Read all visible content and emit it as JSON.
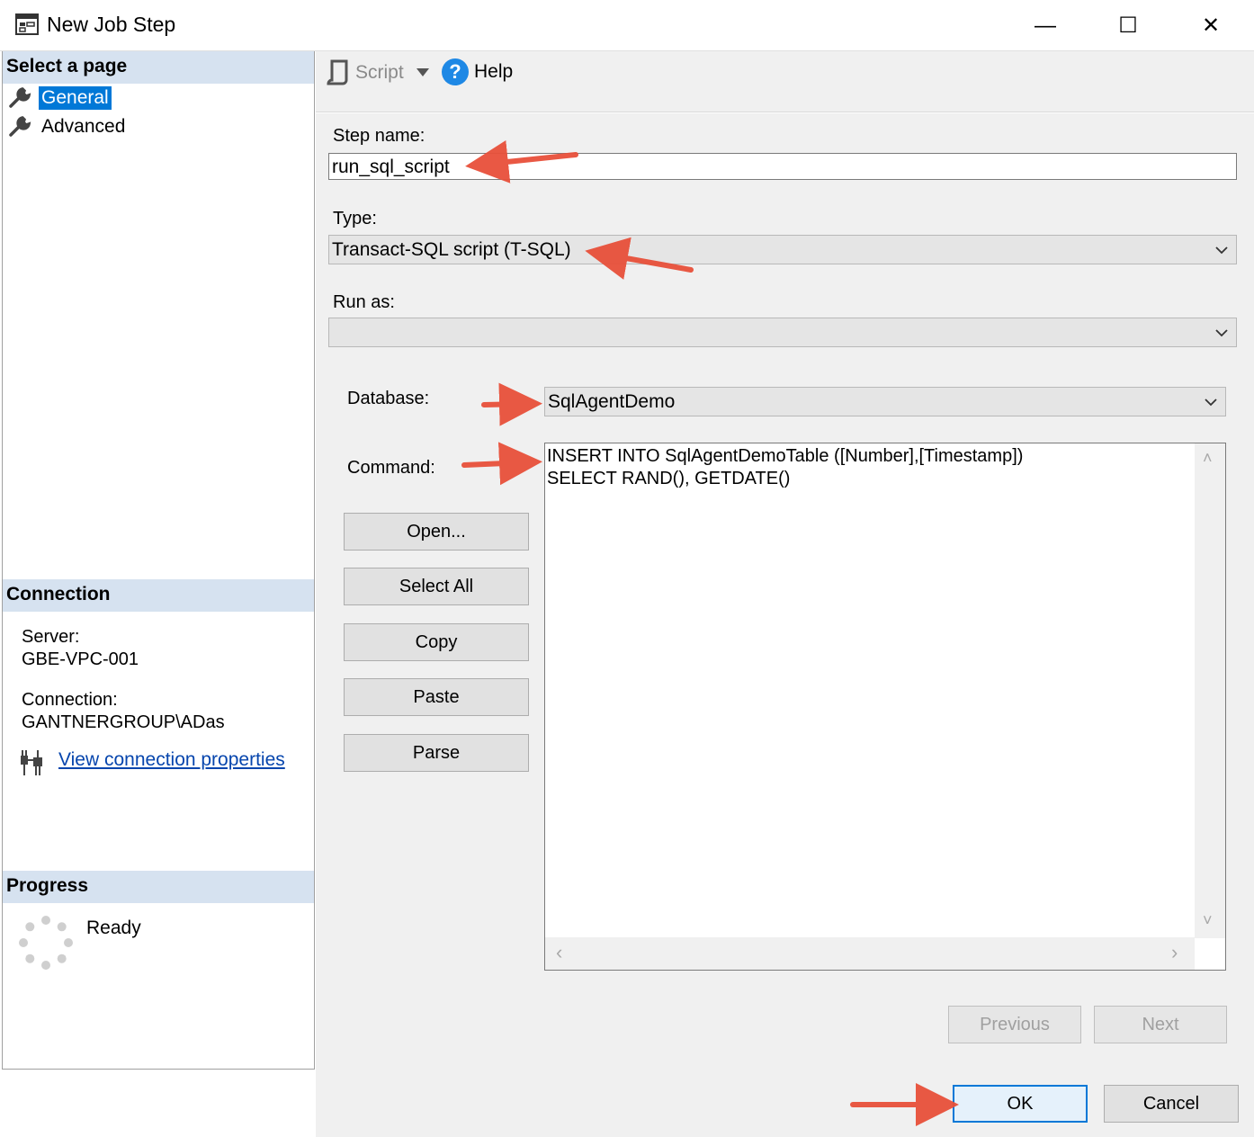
{
  "window": {
    "title": "New Job Step",
    "minimize": "—",
    "maximize": "☐",
    "close": "✕"
  },
  "left_panel": {
    "select_page_header": "Select a page",
    "pages": [
      {
        "label": "General",
        "selected": true
      },
      {
        "label": "Advanced",
        "selected": false
      }
    ],
    "connection_header": "Connection",
    "server_label": "Server:",
    "server_value": "GBE-VPC-001",
    "connection_label": "Connection:",
    "connection_value": "GANTNERGROUP\\ADas",
    "view_connection_link": "View connection properties",
    "progress_header": "Progress",
    "progress_status": "Ready"
  },
  "toolbar": {
    "script_label": "Script",
    "help_label": "Help",
    "help_glyph": "?"
  },
  "form": {
    "step_name_label": "Step name:",
    "step_name_value": "run_sql_script",
    "type_label": "Type:",
    "type_value": "Transact-SQL script (T-SQL)",
    "run_as_label": "Run as:",
    "run_as_value": "",
    "database_label": "Database:",
    "database_value": "SqlAgentDemo",
    "command_label": "Command:",
    "command_lines": [
      "INSERT INTO SqlAgentDemoTable ([Number],[Timestamp])",
      "SELECT RAND(), GETDATE()"
    ],
    "buttons": {
      "open": "Open...",
      "select_all": "Select All",
      "copy": "Copy",
      "paste": "Paste",
      "parse": "Parse"
    },
    "scroll_glyphs": {
      "up": "˄",
      "down": "˅",
      "left": "‹",
      "right": "›"
    }
  },
  "navigation": {
    "previous": "Previous",
    "next": "Next"
  },
  "footer": {
    "ok": "OK",
    "cancel": "Cancel"
  },
  "colors": {
    "accent": "#0078d7",
    "annotation_arrow": "#e8503a",
    "section_header": "#d6e2f0",
    "link": "#0645ad"
  }
}
